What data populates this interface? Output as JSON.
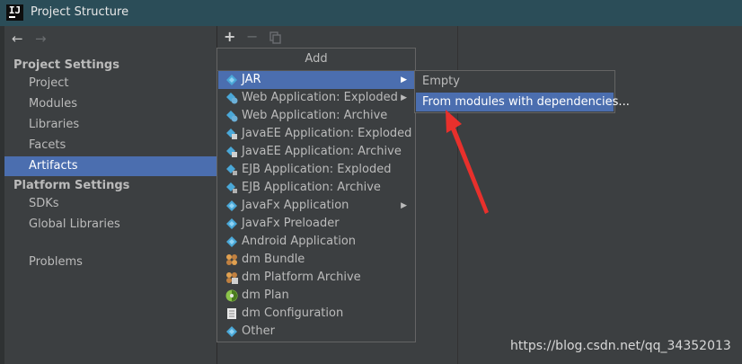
{
  "window": {
    "title": "Project Structure",
    "logo_text": "IJ"
  },
  "nav": {
    "back_icon": "back-arrow-icon",
    "forward_icon": "forward-arrow-icon"
  },
  "sidebar": {
    "project_settings_header": "Project Settings",
    "project_items": [
      {
        "label": "Project",
        "selected": false
      },
      {
        "label": "Modules",
        "selected": false
      },
      {
        "label": "Libraries",
        "selected": false
      },
      {
        "label": "Facets",
        "selected": false
      },
      {
        "label": "Artifacts",
        "selected": true
      }
    ],
    "platform_settings_header": "Platform Settings",
    "platform_items": [
      {
        "label": "SDKs"
      },
      {
        "label": "Global Libraries"
      }
    ],
    "problems_label": "Problems"
  },
  "toolbar": {
    "add_icon": "+",
    "remove_icon": "−"
  },
  "add_menu": {
    "title": "Add",
    "items": [
      {
        "label": "JAR",
        "icon": "jar-icon",
        "has_submenu": true,
        "selected": true
      },
      {
        "label": "Web Application: Exploded",
        "icon": "web-app-icon",
        "has_submenu": true
      },
      {
        "label": "Web Application: Archive",
        "icon": "web-app-icon"
      },
      {
        "label": "JavaEE Application: Exploded",
        "icon": "javaee-icon"
      },
      {
        "label": "JavaEE Application: Archive",
        "icon": "javaee-icon"
      },
      {
        "label": "EJB Application: Exploded",
        "icon": "ejb-icon"
      },
      {
        "label": "EJB Application: Archive",
        "icon": "ejb-icon"
      },
      {
        "label": "JavaFx Application",
        "icon": "javafx-icon",
        "has_submenu": true
      },
      {
        "label": "JavaFx Preloader",
        "icon": "javafx-icon"
      },
      {
        "label": "Android Application",
        "icon": "android-icon"
      },
      {
        "label": "dm Bundle",
        "icon": "dm-bundle-icon"
      },
      {
        "label": "dm Platform Archive",
        "icon": "dm-archive-icon"
      },
      {
        "label": "dm Plan",
        "icon": "dm-plan-icon"
      },
      {
        "label": "dm Configuration",
        "icon": "dm-config-icon"
      },
      {
        "label": "Other",
        "icon": "other-icon"
      }
    ]
  },
  "jar_submenu": {
    "items": [
      {
        "label": "Empty",
        "selected": false
      },
      {
        "label": "From modules with dependencies...",
        "selected": true
      }
    ]
  },
  "watermark": "https://blog.csdn.net/qq_34352013",
  "colors": {
    "selection": "#4b6eaf",
    "titlebar": "#2b4d58",
    "background": "#3c3f41",
    "annotation_arrow": "#e8302c"
  }
}
